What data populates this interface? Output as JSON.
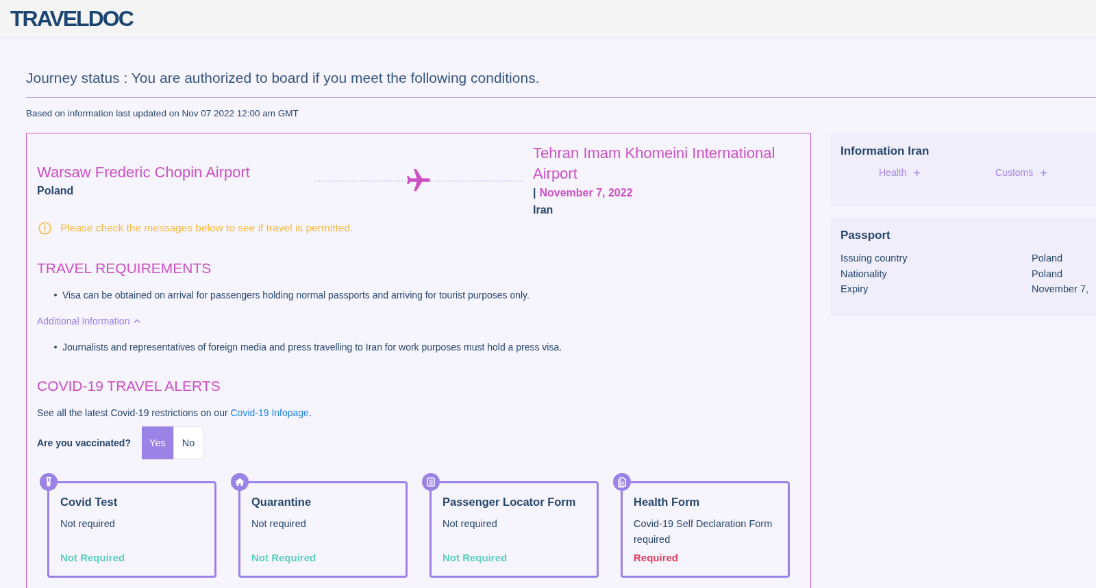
{
  "header": {
    "logo": "TRAVELDOC"
  },
  "journey": {
    "status": "Journey status : You are authorized to board if you meet the following conditions.",
    "updated": "Based on information last updated on Nov 07 2022 12:00 am GMT"
  },
  "route": {
    "from": {
      "airport": "Warsaw Frederic Chopin Airport",
      "country": "Poland"
    },
    "to": {
      "airport": "Tehran Imam Khomeini International Airport",
      "separator": "|",
      "date": "November 7, 2022",
      "country": "Iran"
    }
  },
  "notice": "Please check the messages below to see if travel is permitted.",
  "travel_requirements": {
    "heading": "TRAVEL REQUIREMENTS",
    "items": [
      "Visa can be obtained on arrival for passengers holding normal passports and arriving for tourist purposes only."
    ],
    "additional": {
      "label": "Additional Information",
      "expanded": true,
      "items": [
        "Journalists and representatives of foreign media and press travelling to Iran for work purposes must hold a press visa."
      ]
    }
  },
  "covid": {
    "heading": "COVID-19 TRAVEL ALERTS",
    "intro": {
      "text": "See all the latest Covid-19 restrictions on our ",
      "link": "Covid-19 Infopage",
      "end": "."
    },
    "vaccinated": {
      "question": "Are you vaccinated?",
      "options": [
        {
          "label": "Yes",
          "selected": true
        },
        {
          "label": "No",
          "selected": false
        }
      ]
    },
    "cards": [
      {
        "kind": "test",
        "title": "Covid Test",
        "description": "Not required",
        "status": "Not Required",
        "required": false
      },
      {
        "kind": "quarantine",
        "title": "Quarantine",
        "description": "Not required",
        "status": "Not Required",
        "required": false
      },
      {
        "kind": "locator",
        "title": "Passenger Locator Form",
        "description": "Not required",
        "status": "Not Required",
        "required": false
      },
      {
        "kind": "declaration",
        "title": "Health Form",
        "description": "Covid-19 Self Declaration Form required",
        "status": "Required",
        "required": true
      }
    ]
  },
  "information": {
    "title": "Information Iran",
    "tabs": [
      {
        "label": "Health",
        "expanded": false
      },
      {
        "label": "Customs",
        "expanded": false
      }
    ]
  },
  "passport": {
    "title": "Passport",
    "rows": [
      {
        "label": "Issuing country",
        "value": "Poland"
      },
      {
        "label": "Nationality",
        "value": "Poland"
      },
      {
        "label": "Expiry",
        "value": "November 7,"
      }
    ]
  }
}
